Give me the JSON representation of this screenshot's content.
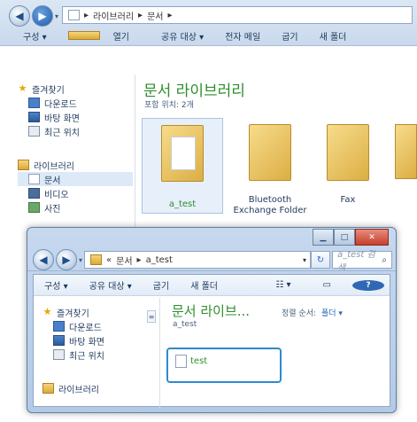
{
  "back_window": {
    "breadcrumb": [
      "라이브러리",
      "문서"
    ],
    "toolbar": [
      "구성 ▾",
      "열기",
      "공유 대상 ▾",
      "전자 메일",
      "굽기",
      "새 폴더"
    ],
    "nav": {
      "favorites_title": "즐겨찾기",
      "favorites": [
        "다운로드",
        "바탕 화면",
        "최근 위치"
      ],
      "libraries_title": "라이브러리",
      "libraries": [
        "문서",
        "비디오",
        "사진"
      ]
    },
    "title": "문서 라이브러리",
    "subtitle": "포함 위치: 2개",
    "folders": [
      {
        "label": "a_test"
      },
      {
        "label": "Bluetooth Exchange Folder"
      },
      {
        "label": "Fax"
      }
    ]
  },
  "front_window": {
    "breadcrumb_prefix": "«",
    "breadcrumb": [
      "문서",
      "a_test"
    ],
    "search_placeholder": "a_test 검색",
    "toolbar": [
      "구성 ▾",
      "공유 대상 ▾",
      "굽기",
      "새 폴더"
    ],
    "nav": {
      "favorites_title": "즐겨찾기",
      "favorites": [
        "다운로드",
        "바탕 화면",
        "최근 위치"
      ],
      "libraries_title": "라이브러리"
    },
    "title": "문서 라이브...",
    "subtitle": "a_test",
    "arrange_label": "정렬 순서:",
    "arrange_value": "폴더 ▾",
    "file": {
      "name": "test"
    }
  }
}
